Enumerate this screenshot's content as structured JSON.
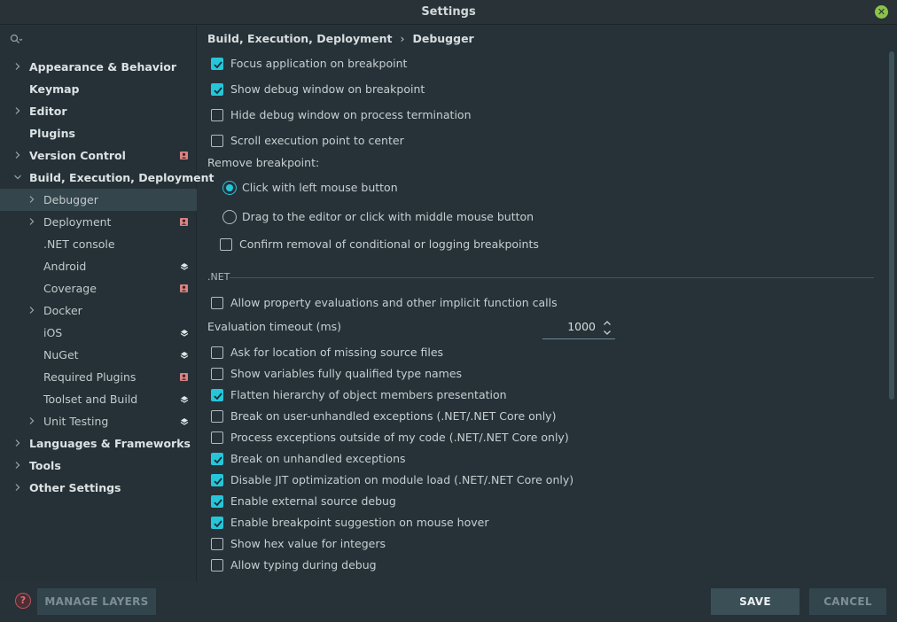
{
  "window": {
    "title": "Settings"
  },
  "sidebar": {
    "search_placeholder": "",
    "items": [
      {
        "label": "Appearance & Behavior",
        "level": 0,
        "bold": true,
        "chevron": "right",
        "badge": ""
      },
      {
        "label": "Keymap",
        "level": 0,
        "bold": true,
        "chevron": "",
        "badge": ""
      },
      {
        "label": "Editor",
        "level": 0,
        "bold": true,
        "chevron": "right",
        "badge": ""
      },
      {
        "label": "Plugins",
        "level": 0,
        "bold": true,
        "chevron": "",
        "badge": ""
      },
      {
        "label": "Version Control",
        "level": 0,
        "bold": true,
        "chevron": "right",
        "badge": "profile"
      },
      {
        "label": "Build, Execution, Deployment",
        "level": 0,
        "bold": true,
        "chevron": "down",
        "badge": ""
      },
      {
        "label": "Debugger",
        "level": 1,
        "bold": false,
        "chevron": "right",
        "badge": "",
        "selected": true
      },
      {
        "label": "Deployment",
        "level": 1,
        "bold": false,
        "chevron": "right",
        "badge": "profile"
      },
      {
        "label": ".NET console",
        "level": 1,
        "bold": false,
        "chevron": "",
        "badge": ""
      },
      {
        "label": "Android",
        "level": 1,
        "bold": false,
        "chevron": "",
        "badge": "layers"
      },
      {
        "label": "Coverage",
        "level": 1,
        "bold": false,
        "chevron": "",
        "badge": "profile"
      },
      {
        "label": "Docker",
        "level": 1,
        "bold": false,
        "chevron": "right",
        "badge": ""
      },
      {
        "label": "iOS",
        "level": 1,
        "bold": false,
        "chevron": "",
        "badge": "layers"
      },
      {
        "label": "NuGet",
        "level": 1,
        "bold": false,
        "chevron": "",
        "badge": "layers"
      },
      {
        "label": "Required Plugins",
        "level": 1,
        "bold": false,
        "chevron": "",
        "badge": "profile"
      },
      {
        "label": "Toolset and Build",
        "level": 1,
        "bold": false,
        "chevron": "",
        "badge": "layers"
      },
      {
        "label": "Unit Testing",
        "level": 1,
        "bold": false,
        "chevron": "right",
        "badge": "layers"
      },
      {
        "label": "Languages & Frameworks",
        "level": 0,
        "bold": true,
        "chevron": "right",
        "badge": ""
      },
      {
        "label": "Tools",
        "level": 0,
        "bold": true,
        "chevron": "right",
        "badge": ""
      },
      {
        "label": "Other Settings",
        "level": 0,
        "bold": true,
        "chevron": "right",
        "badge": ""
      }
    ]
  },
  "breadcrumb": {
    "parent": "Build, Execution, Deployment",
    "separator": "›",
    "current": "Debugger"
  },
  "options": {
    "focus_on_breakpoint": {
      "label": "Focus application on breakpoint",
      "checked": true
    },
    "show_debug_window": {
      "label": "Show debug window on breakpoint",
      "checked": true
    },
    "hide_debug_window": {
      "label": "Hide debug window on process termination",
      "checked": false
    },
    "scroll_execution_point": {
      "label": "Scroll execution point to center",
      "checked": false
    },
    "remove_breakpoint_label": "Remove breakpoint:",
    "radio_left_click": {
      "label": "Click with left mouse button",
      "selected": true
    },
    "radio_drag": {
      "label": "Drag to the editor or click with middle mouse button",
      "selected": false
    },
    "confirm_removal": {
      "label": "Confirm removal of conditional or logging breakpoints",
      "checked": false
    }
  },
  "dotnet": {
    "section_title": ".NET",
    "allow_property_eval": {
      "label": "Allow property evaluations and other implicit function calls",
      "checked": false
    },
    "eval_timeout_label": "Evaluation timeout (ms)",
    "eval_timeout_value": "1000",
    "checks": [
      {
        "label": "Ask for location of missing source files",
        "checked": false
      },
      {
        "label": "Show variables fully qualified type names",
        "checked": false
      },
      {
        "label": "Flatten hierarchy of object members presentation",
        "checked": true
      },
      {
        "label": "Break on user-unhandled exceptions (.NET/.NET Core only)",
        "checked": false
      },
      {
        "label": "Process exceptions outside of my code (.NET/.NET Core only)",
        "checked": false
      },
      {
        "label": "Break on unhandled exceptions",
        "checked": true
      },
      {
        "label": "Disable JIT optimization on module load (.NET/.NET Core only)",
        "checked": true
      },
      {
        "label": "Enable external source debug",
        "checked": true
      },
      {
        "label": "Enable breakpoint suggestion on mouse hover",
        "checked": true
      },
      {
        "label": "Show hex value for integers",
        "checked": false
      },
      {
        "label": "Allow typing during debug",
        "checked": false
      }
    ]
  },
  "footer": {
    "help_label": "?",
    "manage_layers_label": "MANAGE LAYERS",
    "save_label": "SAVE",
    "cancel_label": "CANCEL"
  },
  "colors": {
    "accent": "#26c6da",
    "background": "#263238",
    "profile_badge": "#d98383"
  }
}
